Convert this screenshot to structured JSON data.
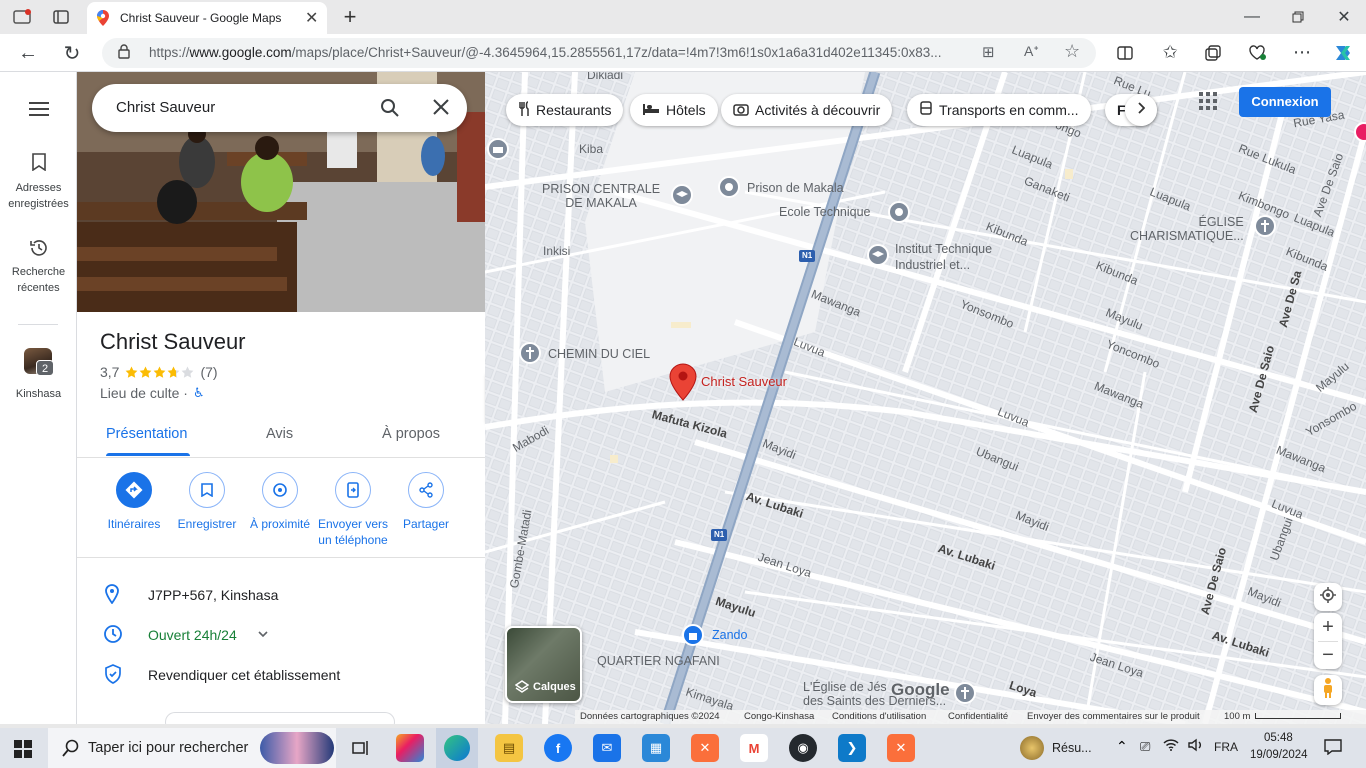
{
  "browser": {
    "tab_title": "Christ Sauveur - Google Maps",
    "url": "https://www.google.com/maps/place/Christ+Sauveur/@-4.3645964,15.2855561,17z/data=!4m7!3m6!1s0x1a6a31d402e11345:0x83...",
    "url_host_bold": "www.google.com"
  },
  "rail": {
    "saved": "Adresses enregistrées",
    "recent": "Recherche récentes",
    "history_label": "Kinshasa",
    "history_badge": "2"
  },
  "search": {
    "value": "Christ Sauveur"
  },
  "place": {
    "name": "Christ Sauveur",
    "rating": "3,7",
    "rating_value": 3.7,
    "reviews": "(7)",
    "category": "Lieu de culte ·"
  },
  "tabs": {
    "overview": "Présentation",
    "reviews": "Avis",
    "about": "À propos"
  },
  "actions": {
    "directions": "Itinéraires",
    "save": "Enregistrer",
    "nearby": "À proximité",
    "send_line1": "Envoyer vers",
    "send_line2": "un téléphone",
    "share": "Partager"
  },
  "info": {
    "plus_code": "J7PP+567, Kinshasa",
    "hours": "Ouvert 24h/24",
    "claim": "Revendiquer cet établissement"
  },
  "chips": {
    "restaurants": "Restaurants",
    "hotels": "Hôtels",
    "activities": "Activités à découvrir",
    "transit": "Transports en comm...",
    "partial": "F"
  },
  "signin": "Connexion",
  "map": {
    "marker": "Christ Sauveur",
    "pois": {
      "prison_centrale_1": "PRISON CENTRALE",
      "prison_centrale_2": "DE MAKALA",
      "prison_makala": "Prison de Makala",
      "ecole": "Ecole Technique",
      "institut_1": "Institut Technique",
      "institut_2": "Industriel et...",
      "chemin": "CHEMIN DU CIEL",
      "eglise_1": "ÉGLISE",
      "eglise_2": "CHARISMATIQUE...",
      "zando": "Zando",
      "quartier": "QUARTIER NGAFANI",
      "eglise_saints_1": "L'Église de Jés",
      "eglise_saints_2": "des Saints des Derniers..."
    },
    "streets": {
      "dikiadi": "Dikiadi",
      "kiba": "Kiba",
      "inkisi": "Inkisi",
      "mabodi": "Mabodi",
      "gombe": "Gombe-Matadi",
      "mafuta": "Mafuta Kizola",
      "mawanga1": "Mawanga",
      "mawanga2": "Mawanga",
      "mawanga3": "Mawanga",
      "luvua1": "Luvua",
      "luvua2": "Luvua",
      "luvua3": "Luvua",
      "mayidi1": "Mayidi",
      "mayidi2": "Mayidi",
      "mayidi3": "Mayidi",
      "ubangui1": "Ubangui",
      "ubangui2": "Ubangui",
      "lubaki1": "Av. Lubaki",
      "lubaki2": "Av. Lubaki",
      "lubaki3": "Av. Lubaki",
      "jeanloya1": "Jean Loya",
      "jeanloya2": "Jean Loya",
      "mayulu1": "Mayulu",
      "mayulu2": "Mayulu",
      "mayulu3": "Mayulu",
      "yonsombo1": "Yonsombo",
      "yonsombo2": "Yoncombo",
      "yonsombo3": "Yonsombo",
      "kibunda1": "Kibunda",
      "kibunda2": "Kibunda",
      "kibunda3": "Kibunda",
      "luapula1": "Luapula",
      "luapula2": "Luapula",
      "luapula3": "Luapula",
      "ganaketi": "Ganaketi",
      "kimbongo": "Kimbongo",
      "lukula": "Rue Lukula",
      "ruelu": "Rue Lu",
      "yasa": "Rue Yasa",
      "ongo": "ongo",
      "desaio1": "Ave De Saio",
      "desaio2": "Ave De Saio",
      "desaio3": "Ave De Saio",
      "desaio4": "Ave De Sa",
      "kimayala": "Kimayala",
      "loya": "Loya",
      "n1a": "N1",
      "n1b": "N1"
    },
    "layers": "Calques",
    "logo": "Google",
    "footer": {
      "data": "Données cartographiques ©2024",
      "country": "Congo-Kinshasa",
      "terms": "Conditions d'utilisation",
      "privacy": "Confidentialité",
      "feedback": "Envoyer des commentaires sur le produit",
      "scale": "100 m"
    }
  },
  "taskbar": {
    "search_placeholder": "Taper ici pour rechercher",
    "app_label": "Résu...",
    "lang": "FRA",
    "time": "05:48",
    "date": "19/09/2024"
  },
  "colors": {
    "accent": "#1a73e8",
    "marker": "#ea4335",
    "star": "#fbbc04",
    "open": "#188038"
  }
}
